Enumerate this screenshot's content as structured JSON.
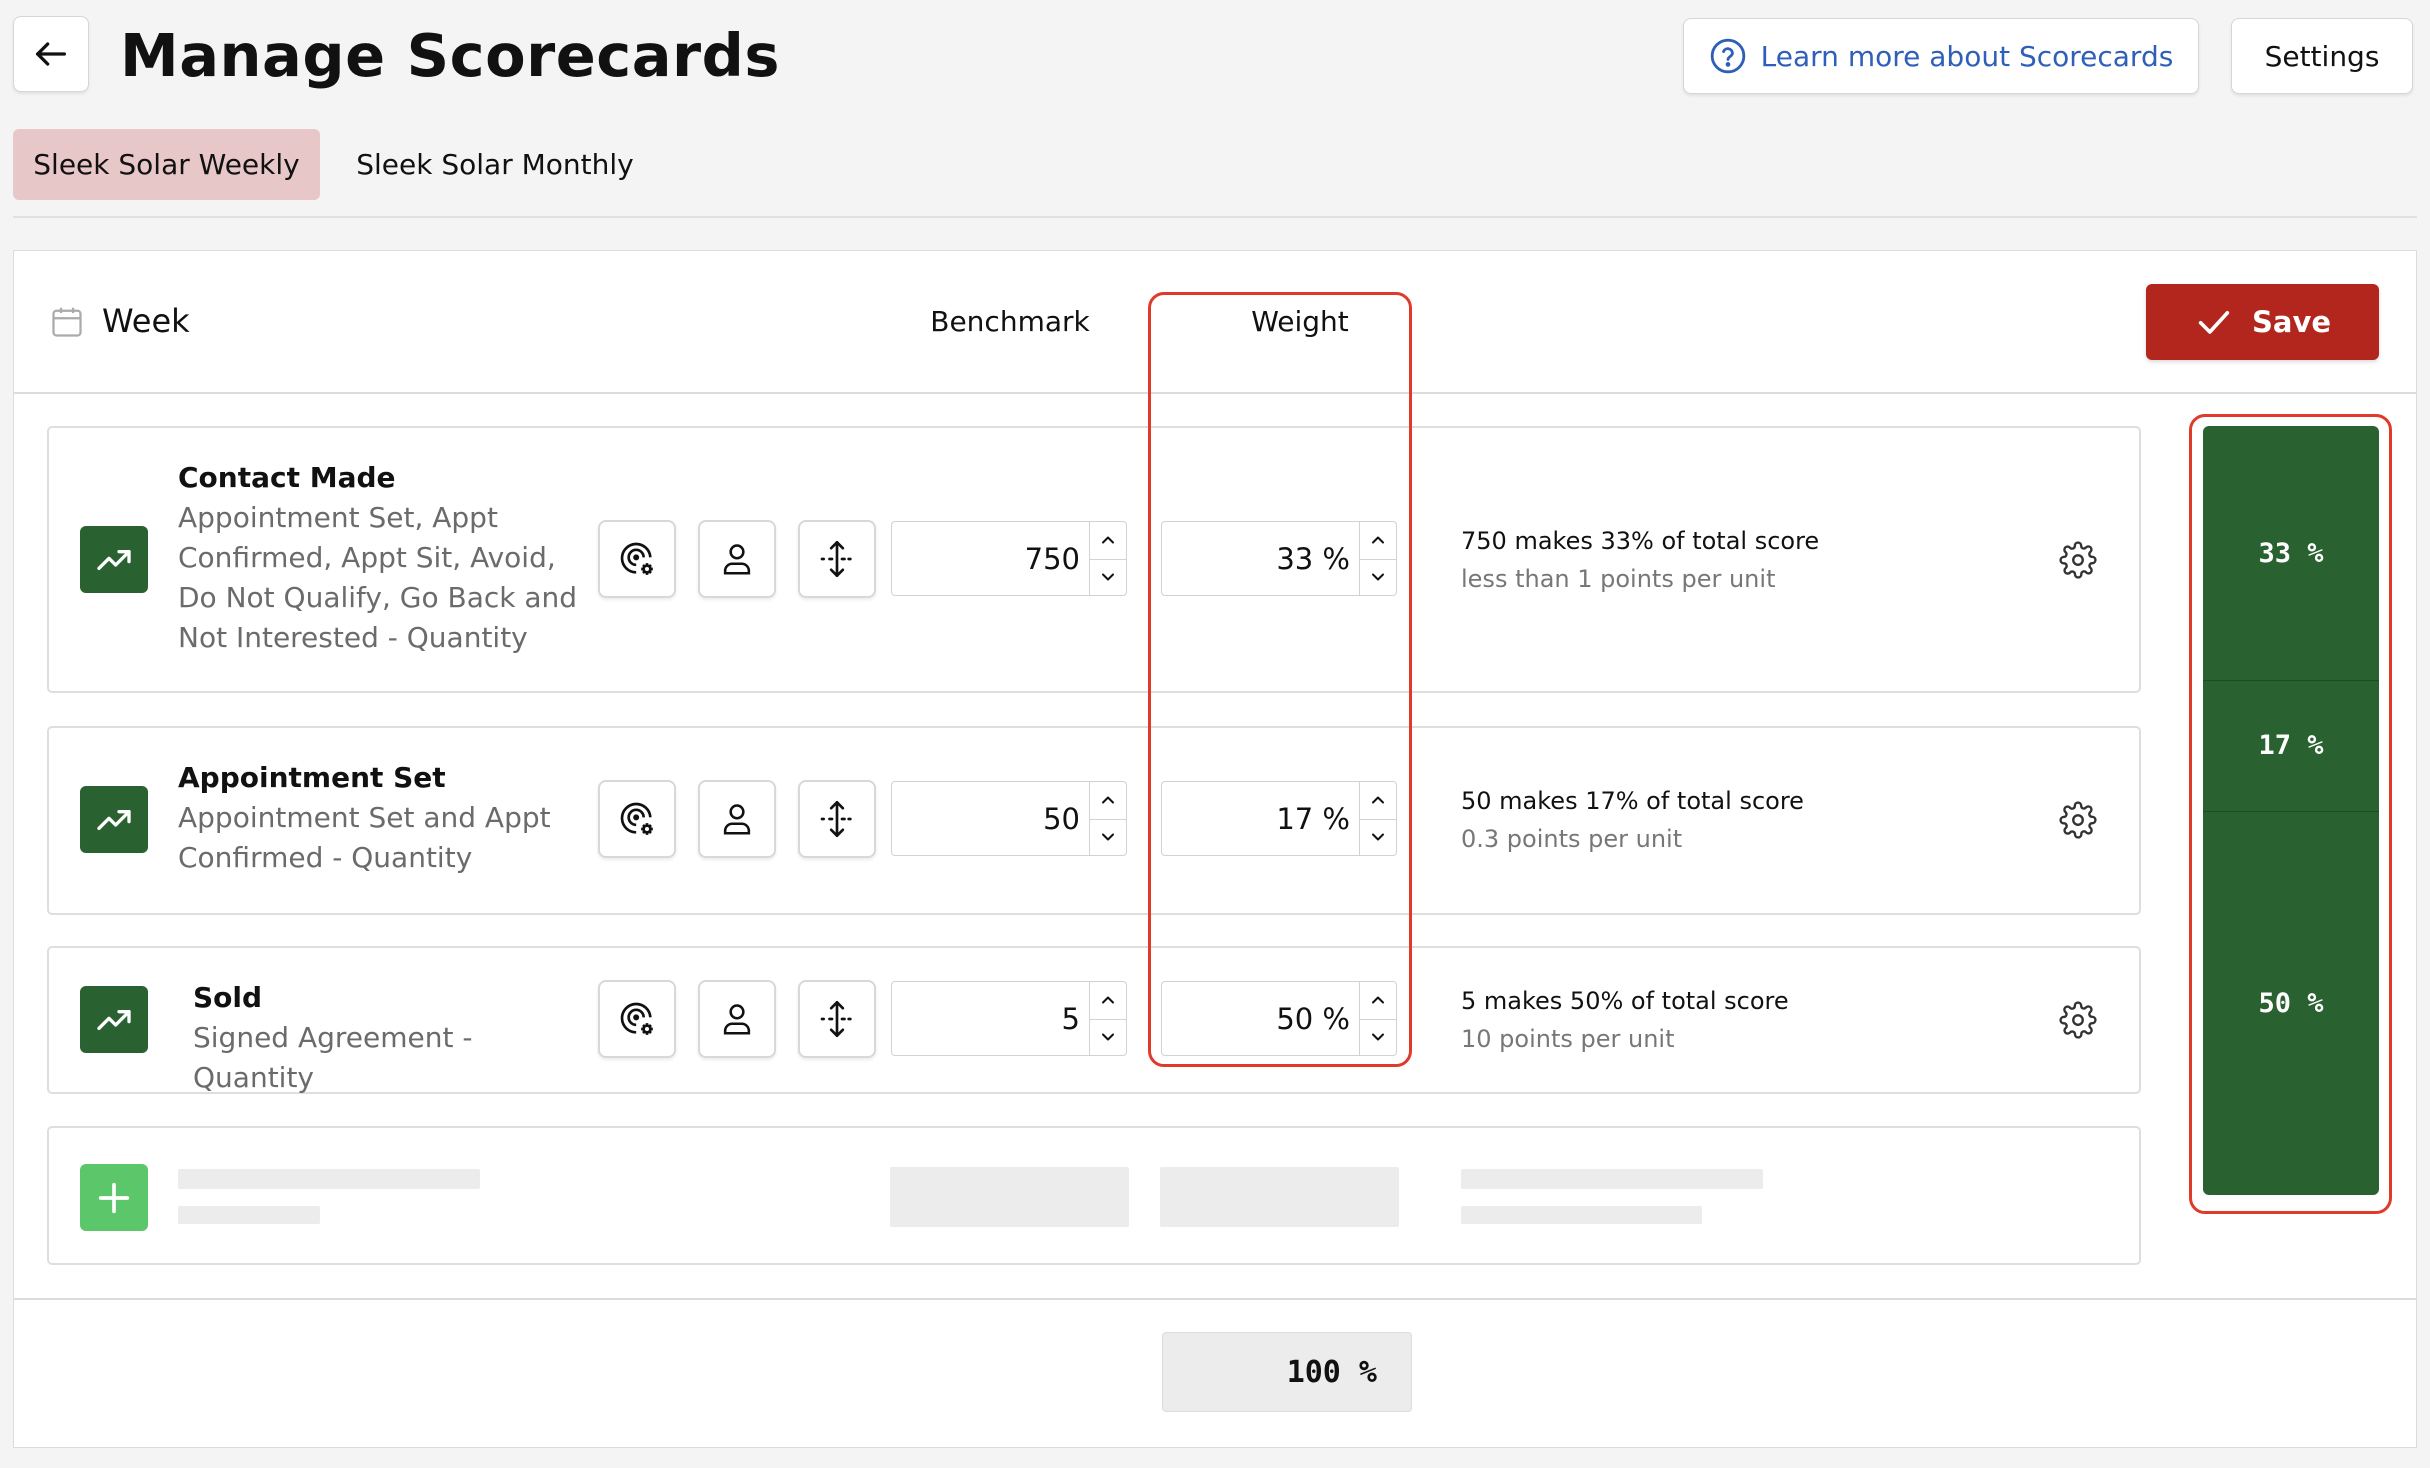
{
  "header": {
    "title": "Manage Scorecards",
    "learn_more": "Learn more about Scorecards",
    "settings": "Settings"
  },
  "tabs": [
    {
      "label": "Sleek Solar Weekly",
      "active": true
    },
    {
      "label": "Sleek Solar Monthly",
      "active": false
    }
  ],
  "toolbar": {
    "period": "Week",
    "benchmark_header": "Benchmark",
    "weight_header": "Weight",
    "save": "Save"
  },
  "metrics": [
    {
      "name": "Contact Made",
      "desc": "Appointment Set, Appt Confirmed, Appt Sit, Avoid, Do Not Qualify, Go Back and Not Interested - Quantity",
      "benchmark": "750",
      "weight": "33 %",
      "summary": "750 makes 33% of total score",
      "points": "less than 1 points per unit"
    },
    {
      "name": "Appointment Set",
      "desc": "Appointment Set and Appt Confirmed - Quantity",
      "benchmark": "50",
      "weight": "17 %",
      "summary": "50 makes 17% of total score",
      "points": "0.3 points per unit"
    },
    {
      "name": "Sold",
      "desc": "Signed Agreement - Quantity",
      "benchmark": "5",
      "weight": "50 %",
      "summary": "5 makes 50% of total score",
      "points": "10 points per unit"
    }
  ],
  "weight_bar": [
    {
      "label": "33 %",
      "fraction": 0.33
    },
    {
      "label": "17 %",
      "fraction": 0.17
    },
    {
      "label": "50 %",
      "fraction": 0.5
    }
  ],
  "total": "100 %",
  "colors": {
    "accent_red": "#b3261e",
    "metric_green": "#2a6131",
    "add_green": "#5bc76a",
    "active_tab": "#e8c7c8",
    "link_blue": "#2f5fb8",
    "highlight_red": "#e03a2a"
  },
  "icons": [
    "back-arrow-icon",
    "help-circle-icon",
    "calendar-icon",
    "check-icon",
    "trend-up-icon",
    "target-gear-icon",
    "person-icon",
    "move-icon",
    "chevron-up-icon",
    "chevron-down-icon",
    "gear-icon",
    "plus-icon"
  ]
}
